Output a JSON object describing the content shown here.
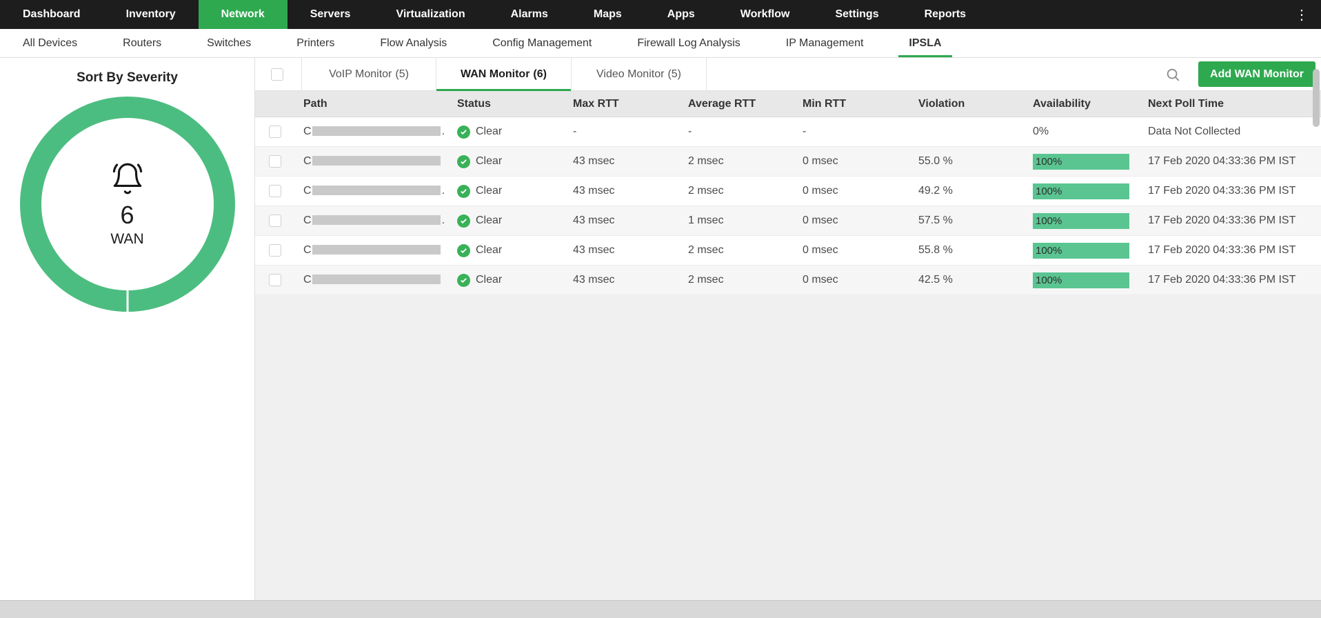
{
  "colors": {
    "accent": "#2EA94F",
    "topnav_bg": "#1D1D1D",
    "donut": "#4CBD80",
    "availability_bar": "#5AC591",
    "status_ok": "#39B158",
    "redaction": "#C9C9C9"
  },
  "topnav": {
    "items": [
      {
        "label": "Dashboard"
      },
      {
        "label": "Inventory"
      },
      {
        "label": "Network",
        "active": true
      },
      {
        "label": "Servers"
      },
      {
        "label": "Virtualization"
      },
      {
        "label": "Alarms"
      },
      {
        "label": "Maps"
      },
      {
        "label": "Apps"
      },
      {
        "label": "Workflow"
      },
      {
        "label": "Settings"
      },
      {
        "label": "Reports"
      }
    ],
    "more_icon": "⋮"
  },
  "subnav": {
    "items": [
      {
        "label": "All Devices"
      },
      {
        "label": "Routers"
      },
      {
        "label": "Switches"
      },
      {
        "label": "Printers"
      },
      {
        "label": "Flow Analysis"
      },
      {
        "label": "Config Management"
      },
      {
        "label": "Firewall Log Analysis"
      },
      {
        "label": "IP Management"
      },
      {
        "label": "IPSLA",
        "active": true
      }
    ]
  },
  "sidebar": {
    "title": "Sort By Severity",
    "donut": {
      "count": "6",
      "label": "WAN"
    }
  },
  "toolbar": {
    "tabs": [
      {
        "label": "VoIP Monitor",
        "count": "(5)"
      },
      {
        "label": "WAN Monitor",
        "count": "(6)",
        "active": true
      },
      {
        "label": "Video Monitor",
        "count": "(5)"
      }
    ],
    "add_button": "Add WAN Monitor"
  },
  "table": {
    "columns": [
      "Path",
      "Status",
      "Max RTT",
      "Average RTT",
      "Min RTT",
      "Violation",
      "Availability",
      "Next Poll Time"
    ],
    "rows": [
      {
        "path_prefix": "C",
        "path_suffix": ".",
        "status": "Clear",
        "max_rtt": "-",
        "avg_rtt": "-",
        "min_rtt": "-",
        "violation": "",
        "availability": "0%",
        "next_poll": "Data Not Collected"
      },
      {
        "path_prefix": "C",
        "path_suffix": "",
        "status": "Clear",
        "max_rtt": "43 msec",
        "avg_rtt": "2 msec",
        "min_rtt": "0 msec",
        "violation": "55.0 %",
        "availability": "100%",
        "next_poll": "17 Feb 2020 04:33:36 PM IST"
      },
      {
        "path_prefix": "C",
        "path_suffix": ".",
        "status": "Clear",
        "max_rtt": "43 msec",
        "avg_rtt": "2 msec",
        "min_rtt": "0 msec",
        "violation": "49.2 %",
        "availability": "100%",
        "next_poll": "17 Feb 2020 04:33:36 PM IST"
      },
      {
        "path_prefix": "C",
        "path_suffix": ".",
        "status": "Clear",
        "max_rtt": "43 msec",
        "avg_rtt": "1 msec",
        "min_rtt": "0 msec",
        "violation": "57.5 %",
        "availability": "100%",
        "next_poll": "17 Feb 2020 04:33:36 PM IST"
      },
      {
        "path_prefix": "C",
        "path_suffix": "",
        "status": "Clear",
        "max_rtt": "43 msec",
        "avg_rtt": "2 msec",
        "min_rtt": "0 msec",
        "violation": "55.8 %",
        "availability": "100%",
        "next_poll": "17 Feb 2020 04:33:36 PM IST"
      },
      {
        "path_prefix": "C",
        "path_suffix": "",
        "status": "Clear",
        "max_rtt": "43 msec",
        "avg_rtt": "2 msec",
        "min_rtt": "0 msec",
        "violation": "42.5 %",
        "availability": "100%",
        "next_poll": "17 Feb 2020 04:33:36 PM IST"
      }
    ]
  }
}
